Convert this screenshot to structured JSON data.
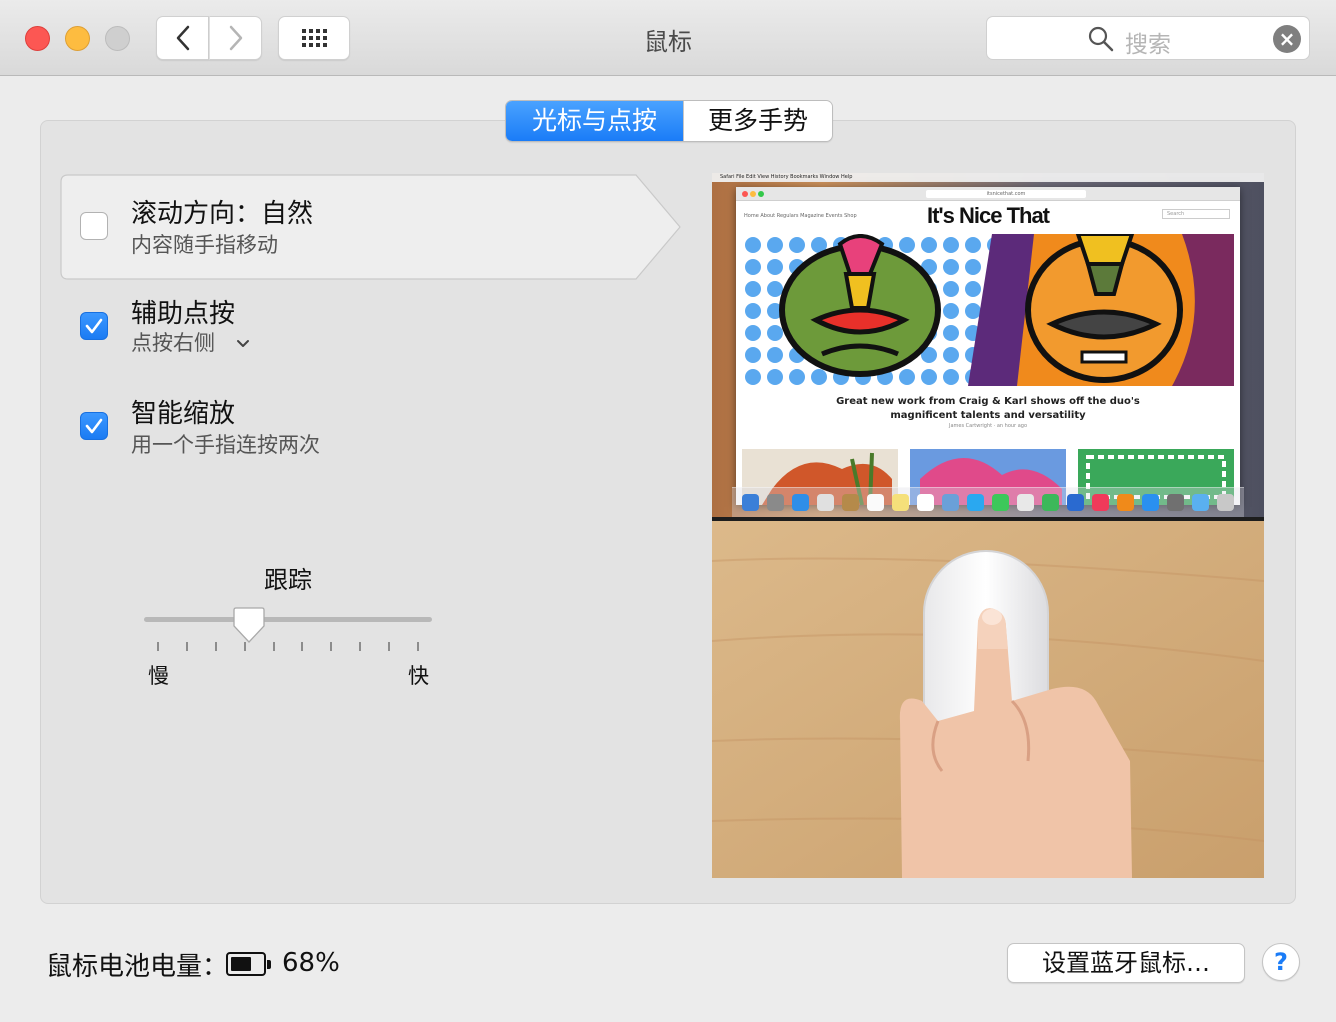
{
  "window": {
    "title": "鼠标",
    "search_placeholder": "搜索"
  },
  "tabs": [
    {
      "label": "光标与点按",
      "active": true
    },
    {
      "label": "更多手势",
      "active": false
    }
  ],
  "options": [
    {
      "title": "滚动方向：自然",
      "subtitle": "内容随手指移动",
      "checked": false
    },
    {
      "title": "辅助点按",
      "subtitle": "点按右侧",
      "checked": true
    },
    {
      "title": "智能缩放",
      "subtitle": "用一个手指连按两次",
      "checked": true
    }
  ],
  "tracking": {
    "title": "跟踪",
    "min_label": "慢",
    "max_label": "快",
    "value_fraction": 0.35,
    "tick_count": 10
  },
  "preview": {
    "browser_url": "itsnicethat.com",
    "brand": "It's Nice That",
    "nav_links": "Home   About   Regulars   Magazine   Events   Shop",
    "search_placeholder": "Search",
    "headline_line1": "Great new work from Craig & Karl shows off the duo's",
    "headline_line2": "magnificent talents and versatility",
    "byline": "James Cartwright · an hour ago",
    "menubar": "Safari   File   Edit   View   History   Bookmarks   Window   Help"
  },
  "battery": {
    "label": "鼠标电池电量：",
    "percent_text": "68%",
    "level": 0.68
  },
  "buttons": {
    "bluetooth": "设置蓝牙鼠标…",
    "help": "?"
  },
  "colors": {
    "accent": "#1a7cf7",
    "close": "#fc5753",
    "minimize": "#fdbc40",
    "zoom_disabled": "#cfcfcf"
  }
}
